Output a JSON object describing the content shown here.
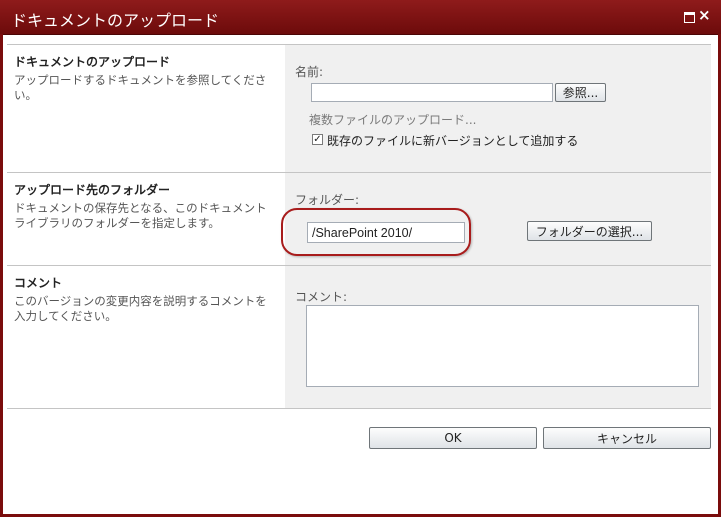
{
  "dialog": {
    "title": "ドキュメントのアップロード",
    "maximize_icon": "maximize-icon",
    "close_icon": "close-icon"
  },
  "upload_section": {
    "title": "ドキュメントのアップロード",
    "description": "アップロードするドキュメントを参照してください。",
    "name_label": "名前:",
    "name_value": "",
    "browse_label": "参照...",
    "multiple_upload_link": "複数ファイルのアップロード...",
    "overwrite_label": "既存のファイルに新バージョンとして追加する",
    "overwrite_checked": true
  },
  "destination_section": {
    "title": "アップロード先のフォルダー",
    "description": "ドキュメントの保存先となる、このドキュメント ライブラリのフォルダーを指定します。",
    "folder_label": "フォルダー:",
    "folder_value": "/SharePoint 2010/",
    "choose_folder_label": "フォルダーの選択..."
  },
  "comment_section": {
    "title": "コメント",
    "description": "このバージョンの変更内容を説明するコメントを入力してください。",
    "comment_label": "コメント:",
    "comment_value": ""
  },
  "footer": {
    "ok_label": "OK",
    "cancel_label": "キャンセル"
  },
  "colors": {
    "titlebar": "#7a0c0c",
    "highlight": "#a81c1c",
    "panel": "#f0f0f0"
  }
}
